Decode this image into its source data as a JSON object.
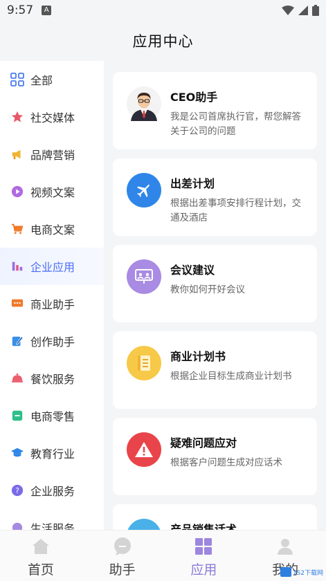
{
  "status": {
    "time": "9:57",
    "a_badge": "A"
  },
  "header": {
    "title": "应用中心"
  },
  "sidebar": {
    "items": [
      {
        "label": "全部",
        "icon": "grid-icon"
      },
      {
        "label": "社交媒体",
        "icon": "star-icon"
      },
      {
        "label": "品牌营销",
        "icon": "megaphone-icon"
      },
      {
        "label": "视频文案",
        "icon": "play-icon"
      },
      {
        "label": "电商文案",
        "icon": "cart-icon"
      },
      {
        "label": "企业应用",
        "icon": "bar-chart-icon"
      },
      {
        "label": "商业助手",
        "icon": "chat-icon"
      },
      {
        "label": "创作助手",
        "icon": "edit-icon"
      },
      {
        "label": "餐饮服务",
        "icon": "cloche-icon"
      },
      {
        "label": "电商零售",
        "icon": "shop-icon"
      },
      {
        "label": "教育行业",
        "icon": "graduation-cap-icon"
      },
      {
        "label": "企业服务",
        "icon": "help-icon"
      },
      {
        "label": "生活服务",
        "icon": "life-icon"
      }
    ],
    "active_index": 5
  },
  "cards": [
    {
      "title": "CEO助手",
      "desc": "我是公司首席执行官，帮您解答关于公司的问题",
      "icon": "ceo-avatar-icon",
      "color": "#ffffff"
    },
    {
      "title": "出差计划",
      "desc": "根据出差事项安排行程计划，交通及酒店",
      "icon": "airplane-icon",
      "color": "#2f86e8"
    },
    {
      "title": "会议建议",
      "desc": "教你如何开好会议",
      "icon": "meeting-icon",
      "color": "#a98be3"
    },
    {
      "title": "商业计划书",
      "desc": "根据企业目标生成商业计划书",
      "icon": "document-icon",
      "color": "#f7c948"
    },
    {
      "title": "疑难问题应对",
      "desc": "根据客户问题生成对应话术",
      "icon": "warning-icon",
      "color": "#e8444a"
    },
    {
      "title": "产品销售话术",
      "desc": "",
      "icon": "sales-icon",
      "color": "#4ab0e8"
    }
  ],
  "bottom_nav": {
    "items": [
      {
        "label": "首页",
        "icon": "home-icon"
      },
      {
        "label": "助手",
        "icon": "chat-bubble-icon"
      },
      {
        "label": "应用",
        "icon": "apps-icon"
      },
      {
        "label": "我的",
        "icon": "user-icon"
      }
    ],
    "active_index": 2
  },
  "watermark": {
    "text": "7S2下载网"
  }
}
